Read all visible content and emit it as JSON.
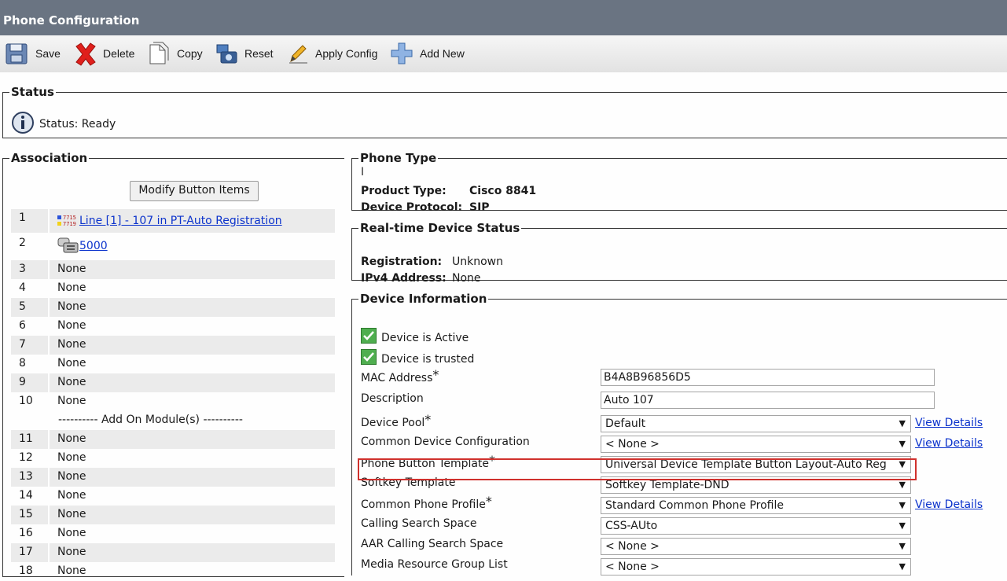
{
  "window": {
    "title": "Phone Configuration"
  },
  "toolbar": {
    "save": "Save",
    "delete": "Delete",
    "copy": "Copy",
    "reset": "Reset",
    "apply_config": "Apply Config",
    "add_new": "Add New"
  },
  "status": {
    "legend": "Status",
    "text": "Status: Ready"
  },
  "association": {
    "legend": "Association",
    "modify_button": "Modify Button Items",
    "rows": [
      {
        "num": "1",
        "value": "Line [1] - 107 in PT-Auto Registration",
        "link": true,
        "icon": "line-icon"
      },
      {
        "num": "2",
        "value": "5000",
        "link": true,
        "icon": "speed-dial-phone-icon"
      },
      {
        "num": "3",
        "value": "None"
      },
      {
        "num": "4",
        "value": "None"
      },
      {
        "num": "5",
        "value": "None"
      },
      {
        "num": "6",
        "value": "None"
      },
      {
        "num": "7",
        "value": "None"
      },
      {
        "num": "8",
        "value": "None"
      },
      {
        "num": "9",
        "value": "None"
      },
      {
        "num": "10",
        "value": "None"
      }
    ],
    "addon_label": "---------- Add On Module(s) ----------",
    "addon_rows": [
      {
        "num": "11",
        "value": "None"
      },
      {
        "num": "12",
        "value": "None"
      },
      {
        "num": "13",
        "value": "None"
      },
      {
        "num": "14",
        "value": "None"
      },
      {
        "num": "15",
        "value": "None"
      },
      {
        "num": "16",
        "value": "None"
      },
      {
        "num": "17",
        "value": "None"
      },
      {
        "num": "18",
        "value": "None"
      }
    ]
  },
  "phone_type": {
    "legend": "Phone Type",
    "product_label": "Product Type:",
    "product_value": "Cisco 8841",
    "protocol_label": "Device Protocol:",
    "protocol_value": "SIP"
  },
  "realtime": {
    "legend": "Real-time Device Status",
    "registration_label": "Registration:",
    "registration_value": "Unknown",
    "ipv4_label": "IPv4 Address:",
    "ipv4_value": "None"
  },
  "device_info": {
    "legend": "Device Information",
    "active_label": "Device is Active",
    "trusted_label": "Device is trusted",
    "view_details": "View Details",
    "fields": {
      "mac": {
        "label": "MAC Address",
        "value": "B4A8B96856D5"
      },
      "description": {
        "label": "Description",
        "value": "Auto 107"
      },
      "device_pool": {
        "label": "Device Pool",
        "value": "Default"
      },
      "common_device_config": {
        "label": "Common Device Configuration",
        "value": "< None >"
      },
      "phone_button_template": {
        "label": "Phone Button Template",
        "value": "Universal Device Template Button Layout-Auto Reg"
      },
      "softkey_template": {
        "label": "Softkey Template",
        "value": "Softkey Template-DND"
      },
      "common_phone_profile": {
        "label": "Common Phone Profile",
        "value": "Standard Common Phone Profile"
      },
      "calling_search_space": {
        "label": "Calling Search Space",
        "value": "CSS-AUto"
      },
      "aar_css": {
        "label": "AAR Calling Search Space",
        "value": "< None >"
      },
      "mrgl": {
        "label": "Media Resource Group List",
        "value": "< None >"
      }
    },
    "required_mark": "*"
  },
  "colors": {
    "titlebar": "#6a7482",
    "link": "#0c33cc",
    "highlight": "#d0312d"
  }
}
